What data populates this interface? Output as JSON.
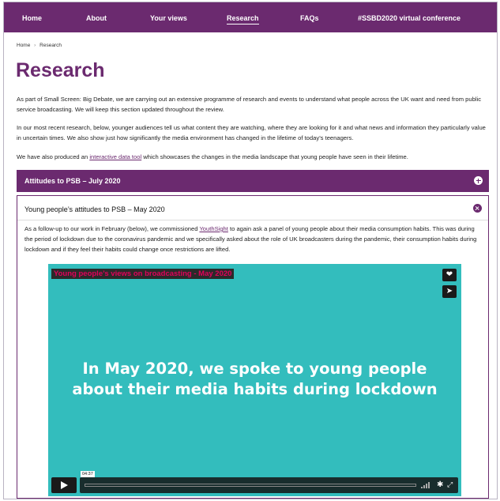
{
  "nav": {
    "items": [
      "Home",
      "About",
      "Your views",
      "Research",
      "FAQs",
      "#SSBD2020 virtual conference"
    ],
    "active": "Research"
  },
  "breadcrumb": {
    "home": "Home",
    "separator": "›",
    "current": "Research"
  },
  "page": {
    "title": "Research",
    "para1": "As part of Small Screen: Big Debate, we are carrying out an extensive programme of research and events to understand what people across the UK want and need from public service broadcasting. We will keep this section updated throughout the review.",
    "para2": "In our most recent research, below, younger audiences tell us what content they are watching, where they are looking for it and what news and information they particularly value in uncertain times. We also show just how significantly the media environment has changed in the lifetime of today’s teenagers.",
    "para3_before": "We have also produced an ",
    "para3_link": "interactive data tool",
    "para3_after": " which showcases the changes in the media landscape that young people have seen in their lifetime."
  },
  "accordion_closed": {
    "title": "Attitudes to PSB – July 2020",
    "icon": "plus-circle-icon"
  },
  "accordion_open": {
    "title": "Young people’s attitudes to PSB – May 2020",
    "icon": "close-circle-icon",
    "body_before": "As a follow-up to our work in February (below), we commissioned ",
    "body_link": "YouthSight",
    "body_after": " to again ask a panel of young people about their media consumption habits. This was during the period of lockdown due to the coronavirus pandemic and we specifically asked about the role of UK broadcasters during the pandemic, their consumption habits during lockdown and if they feel their habits could change once restrictions are lifted."
  },
  "video": {
    "title": "Young people’s views on broadcasting - May 2020",
    "caption_line1": "In May 2020, we spoke to young people",
    "caption_line2": "about their media habits during lockdown",
    "time": "04:37",
    "background": "#33bdbd",
    "title_color": "#e2005a",
    "icons": [
      "heart-icon",
      "send-icon",
      "play-icon",
      "volume-icon",
      "gear-icon",
      "fullscreen-icon"
    ]
  },
  "colors": {
    "brand": "#6b2a6f",
    "text": "#222222"
  }
}
